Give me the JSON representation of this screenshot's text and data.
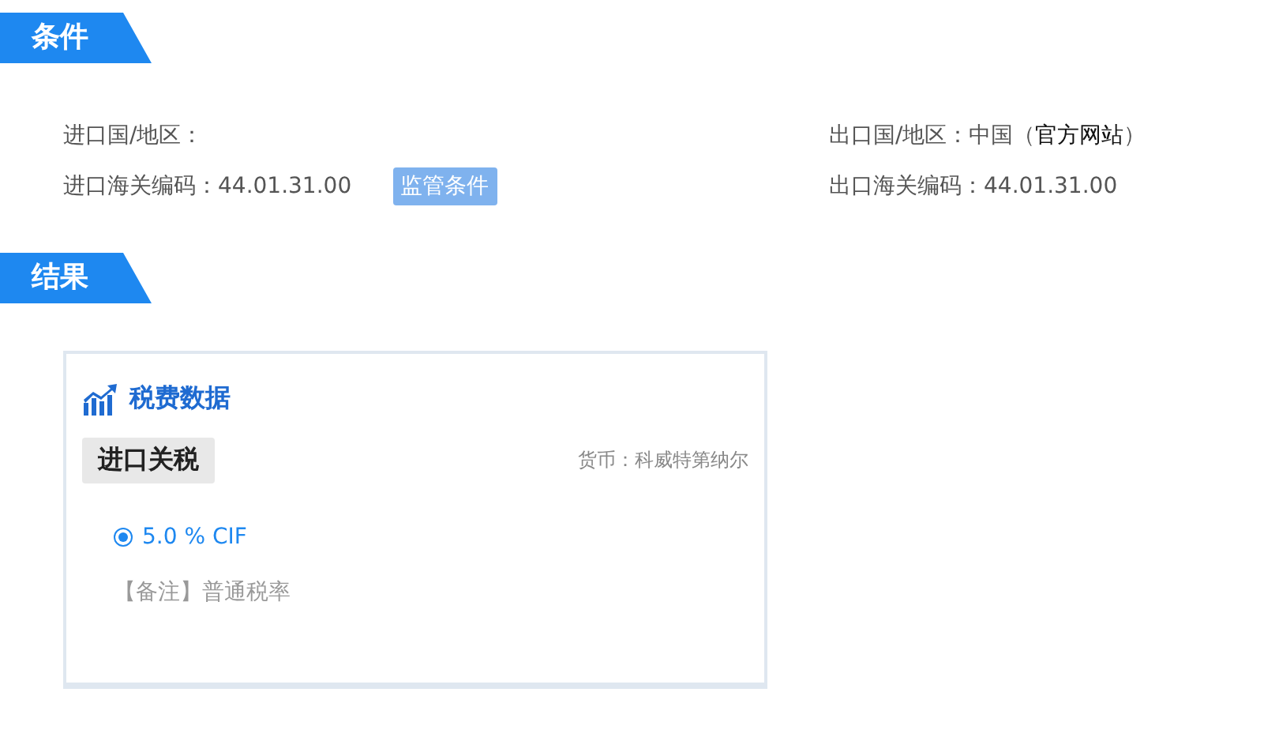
{
  "conditions_heading": "条件",
  "import_region": {
    "label": "进口国/地区："
  },
  "import_code": {
    "label": "进口海关编码：44.01.31.00",
    "button": "监管条件"
  },
  "export_region": {
    "label": "出口国/地区：中国（",
    "link": "官方网站",
    "suffix": "）"
  },
  "export_code": {
    "label": "出口海关编码：44.01.31.00"
  },
  "results_heading": "结果",
  "tax_card": {
    "title": "税费数据",
    "tab": "进口关税",
    "currency": "货币：科威特第纳尔",
    "rates": [
      {
        "text": "5.0 % CIF",
        "selected": true
      }
    ],
    "note": "【备注】普通税率"
  }
}
